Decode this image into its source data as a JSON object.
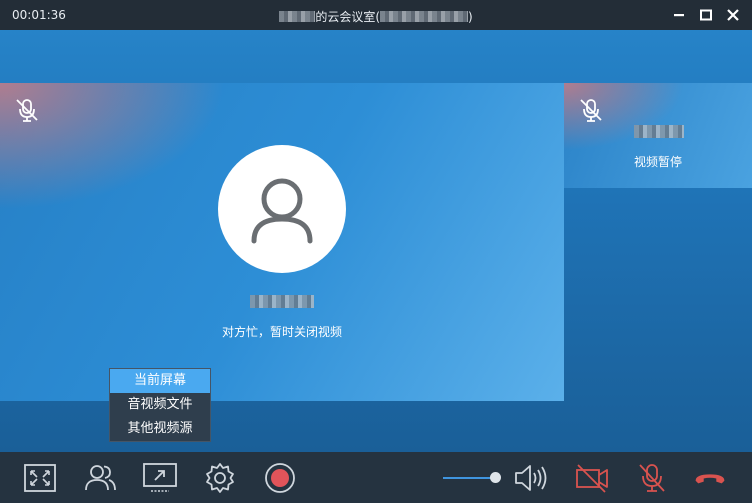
{
  "titlebar": {
    "timer": "00:01:36",
    "title_suffix": "的云会议室(",
    "title_close": ")"
  },
  "main_video": {
    "status": "对方忙，暂时关闭视频",
    "mic_icon": "mic-off-icon",
    "avatar_icon": "user-avatar-icon"
  },
  "side_video": {
    "status": "视频暂停",
    "mic_icon": "mic-off-icon"
  },
  "share_menu": {
    "items": [
      {
        "label": "当前屏幕",
        "active": true
      },
      {
        "label": "音视频文件",
        "active": false
      },
      {
        "label": "其他视频源",
        "active": false
      }
    ]
  },
  "toolbar": {
    "icons": [
      "fullscreen-icon",
      "participants-icon",
      "screen-share-icon",
      "settings-icon",
      "record-icon",
      "speaker-icon",
      "camera-off-icon",
      "mic-off-icon",
      "hangup-icon"
    ],
    "volume": 0.9
  },
  "colors": {
    "titlebar": "#232d37",
    "toolbar": "#253340",
    "accent": "#4aa9f0",
    "record": "#e2545a",
    "danger": "#d9534f"
  }
}
